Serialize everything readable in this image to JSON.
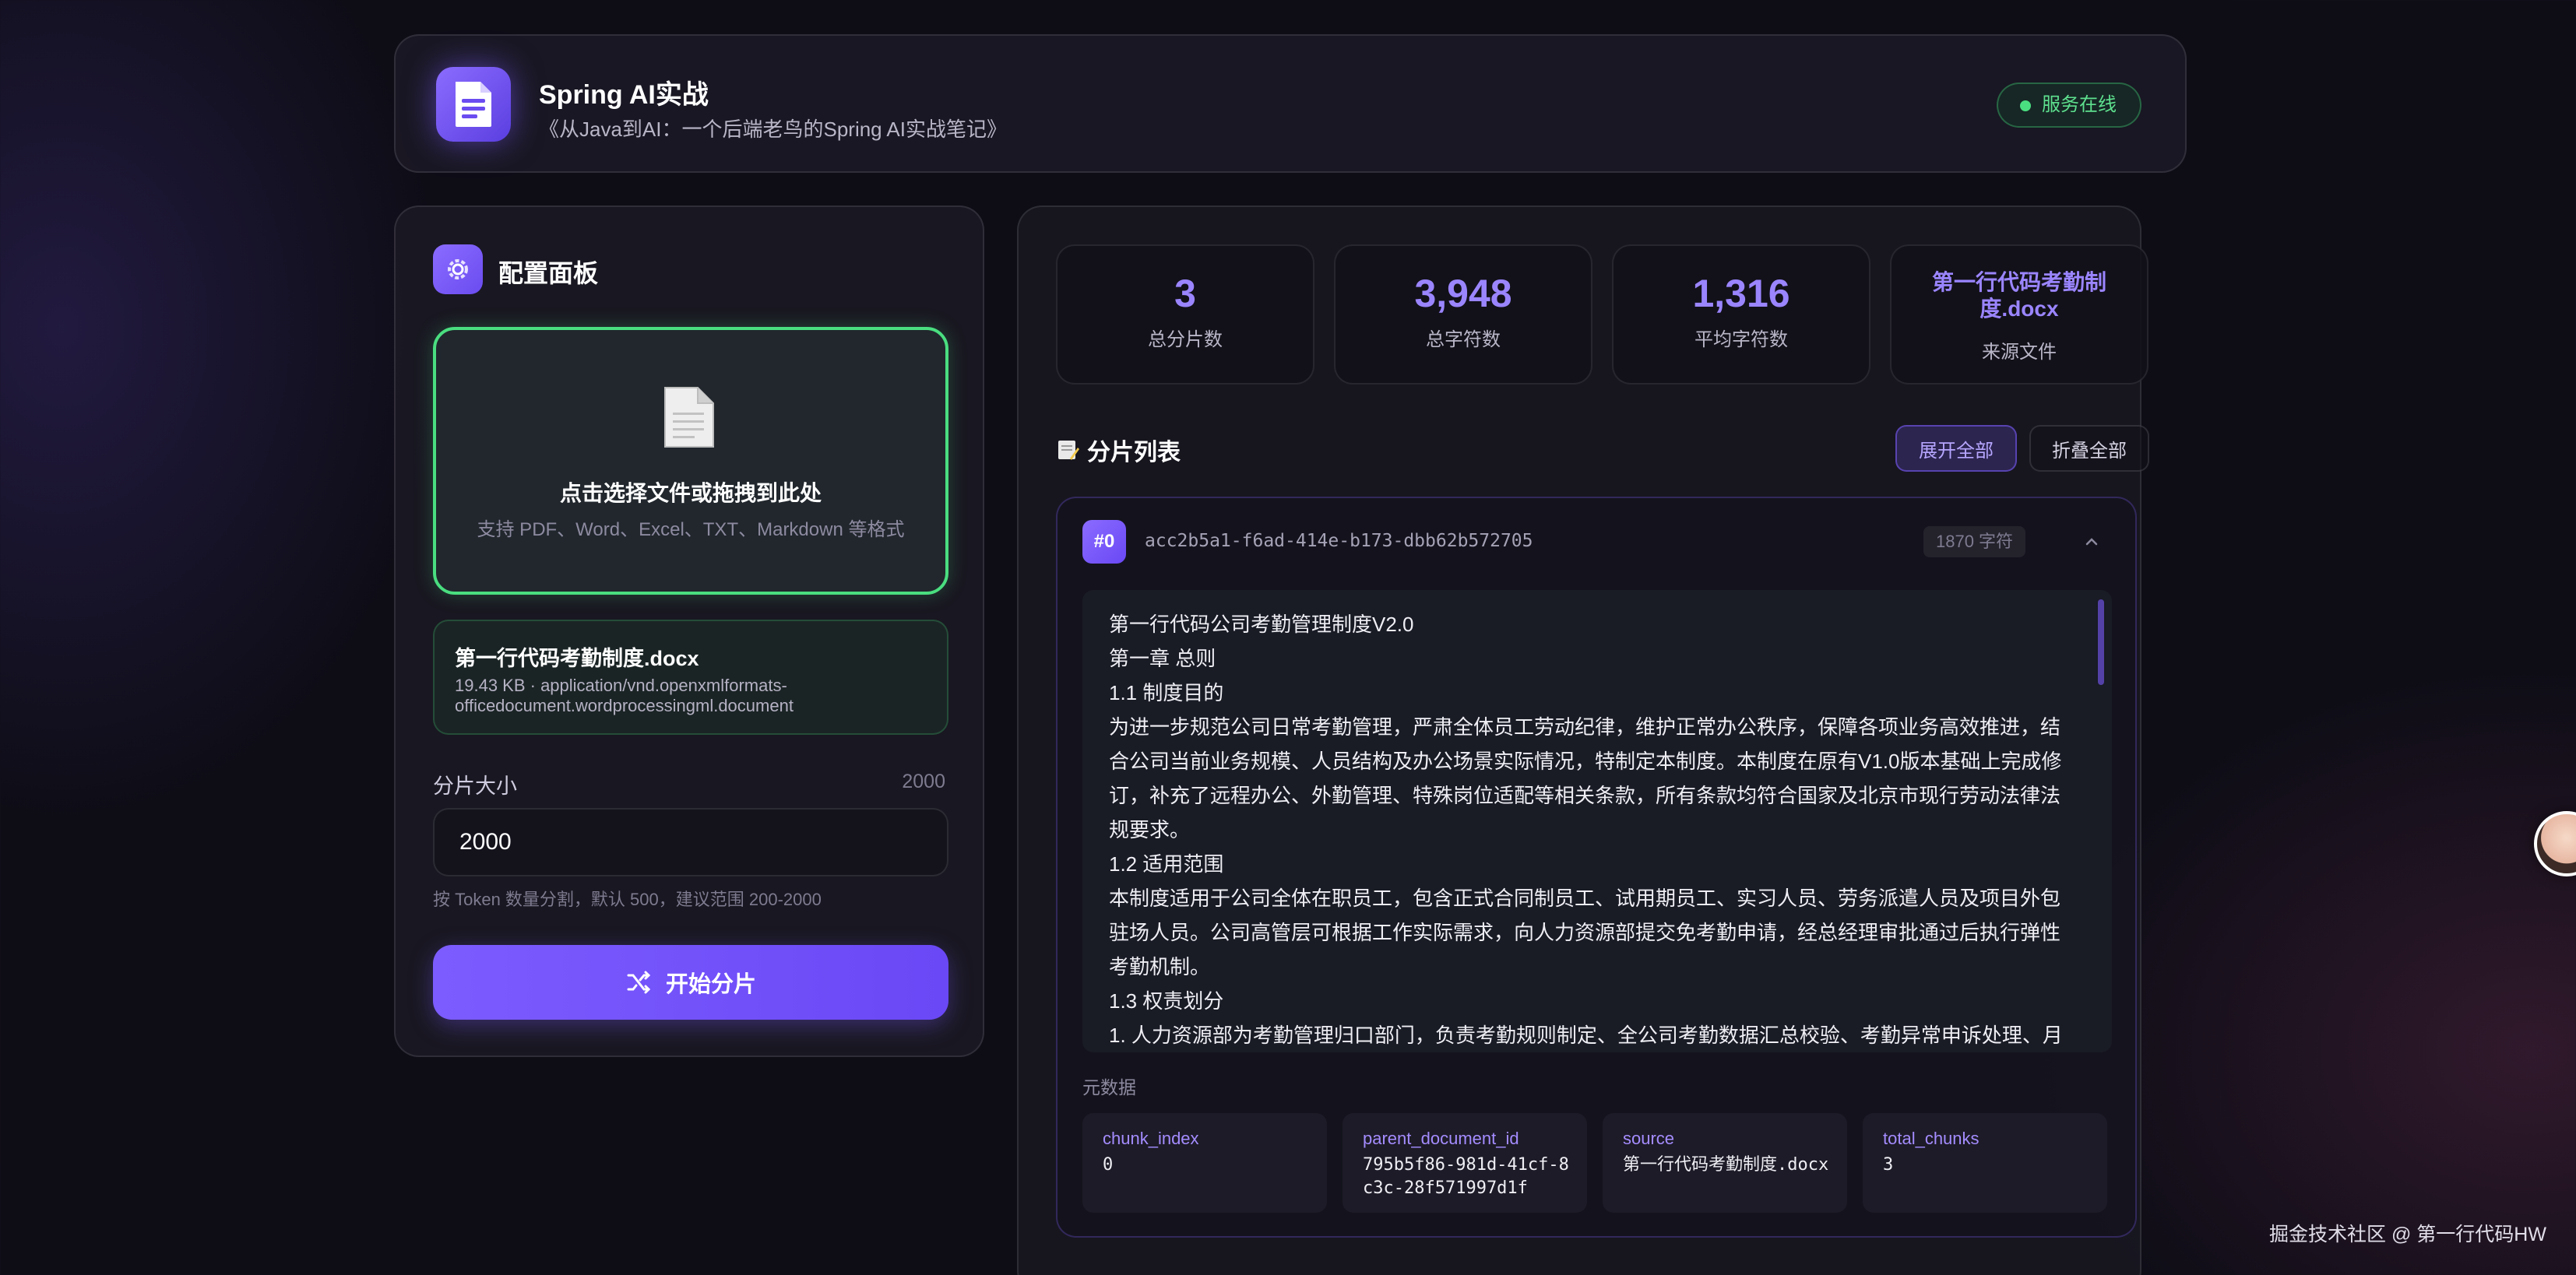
{
  "header": {
    "title": "Spring AI实战",
    "subtitle": "《从Java到AI：一个后端老鸟的Spring AI实战笔记》",
    "status": "服务在线"
  },
  "config": {
    "title": "配置面板",
    "dropzone_main": "点击选择文件或拖拽到此处",
    "dropzone_sub": "支持 PDF、Word、Excel、TXT、Markdown 等格式",
    "file_name": "第一行代码考勤制度.docx",
    "file_meta": "19.43 KB · application/vnd.openxmlformats-officedocument.wordprocessingml.document",
    "chunk_size_label": "分片大小",
    "chunk_size_hint": "2000",
    "chunk_size_value": "2000",
    "chunk_size_help": "按 Token 数量分割，默认 500，建议范围 200-2000",
    "start_label": "开始分片"
  },
  "stats": [
    {
      "value": "3",
      "label": "总分片数"
    },
    {
      "value": "3,948",
      "label": "总字符数"
    },
    {
      "value": "1,316",
      "label": "平均字符数"
    },
    {
      "value": "第一行代码考勤制度.docx",
      "label": "来源文件"
    }
  ],
  "list": {
    "title": "分片列表",
    "expand_all": "展开全部",
    "collapse_all": "折叠全部"
  },
  "chunk": {
    "index": "#0",
    "id": "acc2b5a1-f6ad-414e-b173-dbb62b572705",
    "chars": "1870 字符",
    "lines": [
      "第一行代码公司考勤管理制度V2.0",
      "第一章 总则",
      "1.1 制度目的",
      "为进一步规范公司日常考勤管理，严肃全体员工劳动纪律，维护正常办公秩序，保障各项业务高效推进，结",
      "合公司当前业务规模、人员结构及办公场景实际情况，特制定本制度。本制度在原有V1.0版本基础上完成修",
      "订，补充了远程办公、外勤管理、特殊岗位适配等相关条款，所有条款均符合国家及北京市现行劳动法律法",
      "规要求。",
      "1.2 适用范围",
      "本制度适用于公司全体在职员工，包含正式合同制员工、试用期员工、实习人员、劳务派遣人员及项目外包",
      "驻场人员。公司高管层可根据工作实际需求，向人力资源部提交免考勤申请，经总经理审批通过后执行弹性",
      "考勤机制。",
      "1.3 权责划分",
      "1. 人力资源部为考勤管理归口部门，负责考勤规则制定、全公司考勤数据汇总校验、考勤异常申诉处理、月"
    ],
    "meta_title": "元数据",
    "metadata": [
      {
        "key": "chunk_index",
        "value": "0"
      },
      {
        "key": "parent_document_id",
        "value": "795b5f86-981d-41cf-8c3c-28f571997d1f"
      },
      {
        "key": "source",
        "value": "第一行代码考勤制度.docx"
      },
      {
        "key": "total_chunks",
        "value": "3"
      }
    ]
  },
  "watermark": "掘金技术社区 @ 第一行代码HW",
  "colors": {
    "accent": "#7c5cff",
    "online": "#4ade80",
    "background": "#0e0d16"
  }
}
